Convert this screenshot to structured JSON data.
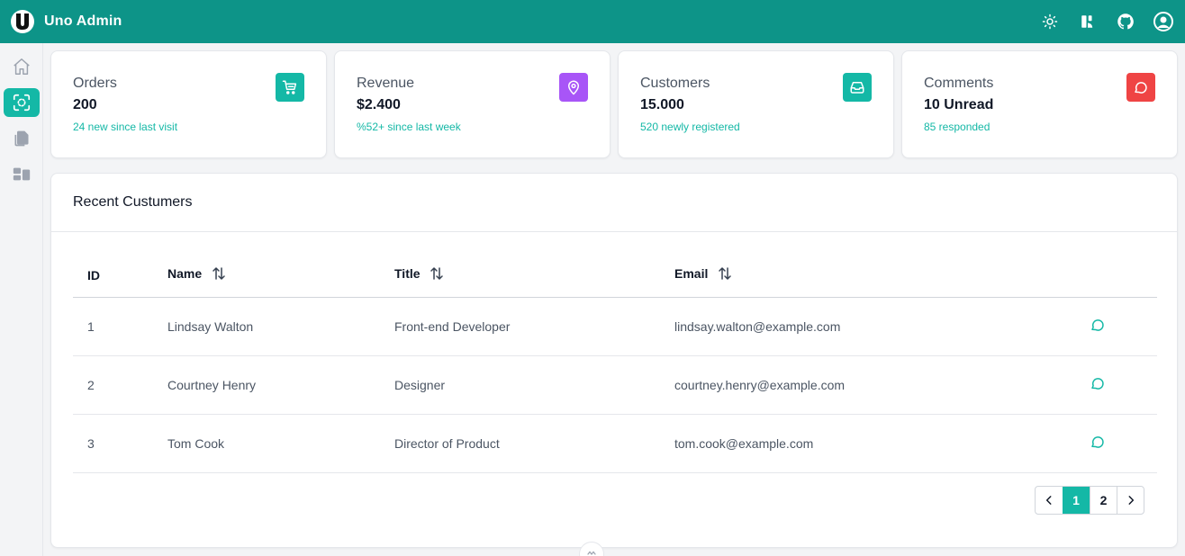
{
  "header": {
    "title": "Uno Admin",
    "actions": [
      {
        "name": "theme-toggle",
        "icon": "sun-icon"
      },
      {
        "name": "framework-link",
        "icon": "unocss-icon"
      },
      {
        "name": "github-link",
        "icon": "github-icon"
      },
      {
        "name": "user-menu",
        "icon": "user-circle-icon"
      }
    ]
  },
  "sidebar": {
    "items": [
      {
        "name": "home",
        "icon": "home-icon",
        "active": false
      },
      {
        "name": "focus",
        "icon": "focus-icon",
        "active": true
      },
      {
        "name": "documents",
        "icon": "documents-icon",
        "active": false
      },
      {
        "name": "dashboard",
        "icon": "dashboard-icon",
        "active": false
      }
    ]
  },
  "stats": [
    {
      "label": "Orders",
      "value": "200",
      "sub": "24 new since last visit",
      "icon": "cart-icon",
      "color": "#14b8a6"
    },
    {
      "label": "Revenue",
      "value": "$2.400",
      "sub": "%52+ since last week",
      "icon": "map-pin-icon",
      "color": "#a855f7"
    },
    {
      "label": "Customers",
      "value": "15.000",
      "sub": "520 newly registered",
      "icon": "inbox-icon",
      "color": "#14b8a6"
    },
    {
      "label": "Comments",
      "value": "10 Unread",
      "sub": "85 responded",
      "icon": "message-icon",
      "color": "#ef4444"
    }
  ],
  "table": {
    "title": "Recent Custumers",
    "columns": [
      "ID",
      "Name",
      "Title",
      "Email"
    ],
    "rows": [
      {
        "id": "1",
        "name": "Lindsay Walton",
        "title": "Front-end Developer",
        "email": "lindsay.walton@example.com"
      },
      {
        "id": "2",
        "name": "Courtney Henry",
        "title": "Designer",
        "email": "courtney.henry@example.com"
      },
      {
        "id": "3",
        "name": "Tom Cook",
        "title": "Director of Product",
        "email": "tom.cook@example.com"
      }
    ]
  },
  "pagination": {
    "pages": [
      "1",
      "2"
    ],
    "current": "1"
  },
  "colors": {
    "brand": "#0d9488",
    "accent": "#14b8a6"
  }
}
